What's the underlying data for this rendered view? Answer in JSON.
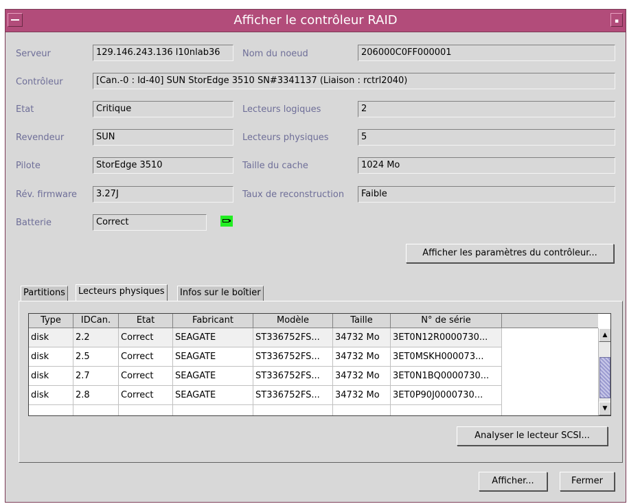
{
  "window": {
    "title": "Afficher le contrôleur RAID",
    "titlebar_color": "#b24c7a"
  },
  "fields": {
    "serveur": {
      "label": "Serveur",
      "value": "129.146.243.136 l10nlab36"
    },
    "nom_noeud": {
      "label": "Nom du noeud",
      "value": "206000C0FF000001"
    },
    "controleur": {
      "label": "Contrôleur",
      "value": "[Can.-0 : Id-40] SUN StorEdge 3510 SN#3341137  (Liaison : rctrl2040)"
    },
    "etat": {
      "label": "Etat",
      "value": "Critique"
    },
    "lecteurs_logiques": {
      "label": "Lecteurs logiques",
      "value": "2"
    },
    "revendeur": {
      "label": "Revendeur",
      "value": "SUN"
    },
    "lecteurs_physiques": {
      "label": "Lecteurs physiques",
      "value": "5"
    },
    "pilote": {
      "label": "Pilote",
      "value": "StorEdge 3510"
    },
    "taille_cache": {
      "label": "Taille du cache",
      "value": "1024 Mo"
    },
    "rev_firmware": {
      "label": "Rév. firmware",
      "value": "3.27J"
    },
    "taux_reconstruction": {
      "label": "Taux de reconstruction",
      "value": "Faible"
    },
    "batterie": {
      "label": "Batterie",
      "value": "Correct",
      "icon": "battery-icon",
      "icon_color": "#22ee22"
    }
  },
  "buttons": {
    "parametres": "Afficher les paramètres du contrôleur...",
    "analyser": "Analyser le lecteur SCSI...",
    "afficher": "Afficher...",
    "fermer": "Fermer"
  },
  "tabs": [
    {
      "label": "Partitions",
      "active": false
    },
    {
      "label": "Lecteurs physiques",
      "active": true
    },
    {
      "label": "Infos sur le boîtier",
      "active": false
    }
  ],
  "table": {
    "columns": [
      "Type",
      "IDCan.",
      "Etat",
      "Fabricant",
      "Modèle",
      "Taille",
      "N° de série"
    ],
    "rows": [
      [
        "disk",
        "2.2",
        "Correct",
        "SEAGATE",
        "ST336752FS...",
        "34732 Mo",
        "3ET0N12R0000730..."
      ],
      [
        "disk",
        "2.5",
        "Correct",
        "SEAGATE",
        "ST336752FS...",
        "34732 Mo",
        "3ET0MSKH000073..."
      ],
      [
        "disk",
        "2.7",
        "Correct",
        "SEAGATE",
        "ST336752FS...",
        "34732 Mo",
        "3ET0N1BQ0000730..."
      ],
      [
        "disk",
        "2.8",
        "Correct",
        "SEAGATE",
        "ST336752FS...",
        "34732 Mo",
        "3ET0P90J0000730..."
      ]
    ]
  }
}
